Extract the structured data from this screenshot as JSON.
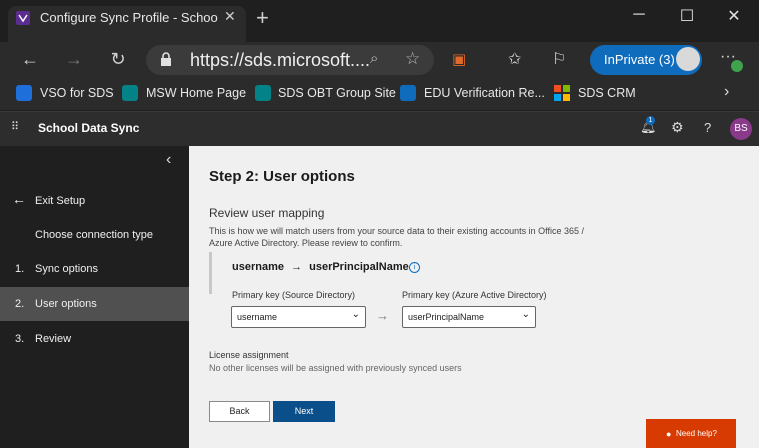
{
  "browser": {
    "tab_title": "Configure Sync Profile - School D",
    "url": "https://sds.microsoft....",
    "inprivate_label": "InPrivate (3)",
    "favorites": [
      "VSO for SDS",
      "MSW Home Page",
      "SDS OBT Group Site",
      "EDU Verification Re...",
      "SDS CRM"
    ]
  },
  "app": {
    "title": "School Data Sync",
    "notification_count": "1",
    "user_initials": "BS"
  },
  "sidebar": {
    "exit_label": "Exit Setup",
    "items": [
      {
        "num": "",
        "label": "Choose connection type"
      },
      {
        "num": "1.",
        "label": "Sync options"
      },
      {
        "num": "2.",
        "label": "User options"
      },
      {
        "num": "3.",
        "label": "Review"
      }
    ]
  },
  "main": {
    "title": "Step 2: User options",
    "review_heading": "Review user mapping",
    "description_line1": "This is how we will match users from your source data to their existing accounts in Office 365 /",
    "description_line2": "Azure Active Directory. Please review to confirm.",
    "map_source": "username",
    "map_target": "userPrincipalName",
    "pk_source_label": "Primary key (Source Directory)",
    "pk_target_label": "Primary key (Azure Active Directory)",
    "pk_source_value": "username",
    "pk_target_value": "userPrincipalName",
    "license_heading": "License assignment",
    "license_text": "No other licenses will be assigned with previously synced users",
    "back_label": "Back",
    "next_label": "Next",
    "help_label": "Need help?"
  }
}
